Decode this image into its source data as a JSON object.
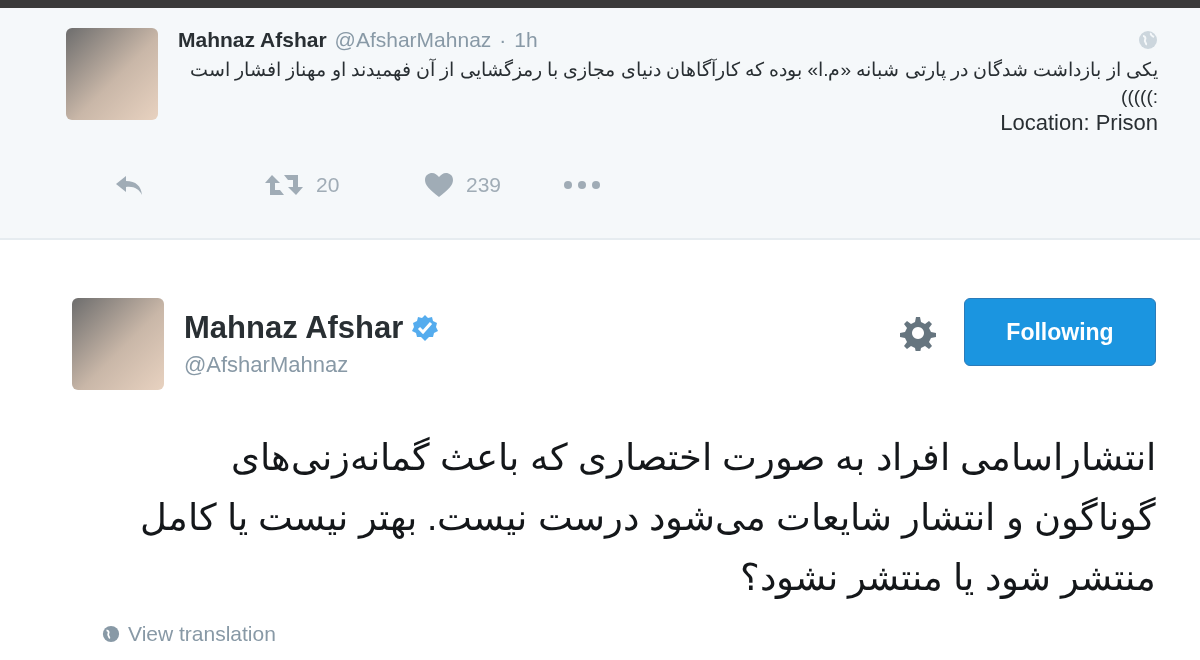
{
  "reply_tweet": {
    "name": "Mahnaz Afshar",
    "handle": "@AfsharMahnaz",
    "separator": "·",
    "time": "1h",
    "text": "یکی از بازداشت شدگان در پارتی شبانه «م.ا» بوده که کارآگاهان دنیای مجازی با رمزگشایی از آن فهمیدند او مهناز افشار است :)))))",
    "location": "Location: Prison",
    "retweets": "20",
    "likes": "239"
  },
  "main_tweet": {
    "name": "Mahnaz Afshar",
    "verified": true,
    "handle": "@AfsharMahnaz",
    "follow_button": {
      "label": "Following",
      "selected": true
    },
    "text": "انتشاراسامی افراد به صورت اختصاری که باعث گمانه‌زنی‌های گوناگون و انتشار شایعات می‌شود درست نیست. بهتر نیست یا کامل منتشر شود یا منتشر نشود؟",
    "translate_link": "View translation"
  }
}
